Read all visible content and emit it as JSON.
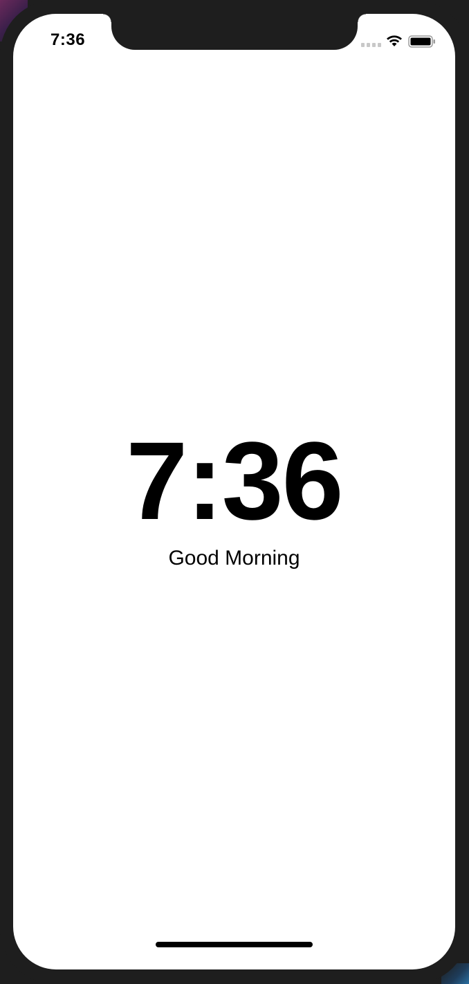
{
  "status_bar": {
    "time": "7:36",
    "signal_icon": "cellular-signal-icon",
    "wifi_icon": "wifi-icon",
    "battery_icon": "battery-icon"
  },
  "main": {
    "clock": "7:36",
    "greeting": "Good Morning"
  },
  "colors": {
    "background": "#ffffff",
    "text": "#000000",
    "device_frame": "#1e1e1e"
  }
}
